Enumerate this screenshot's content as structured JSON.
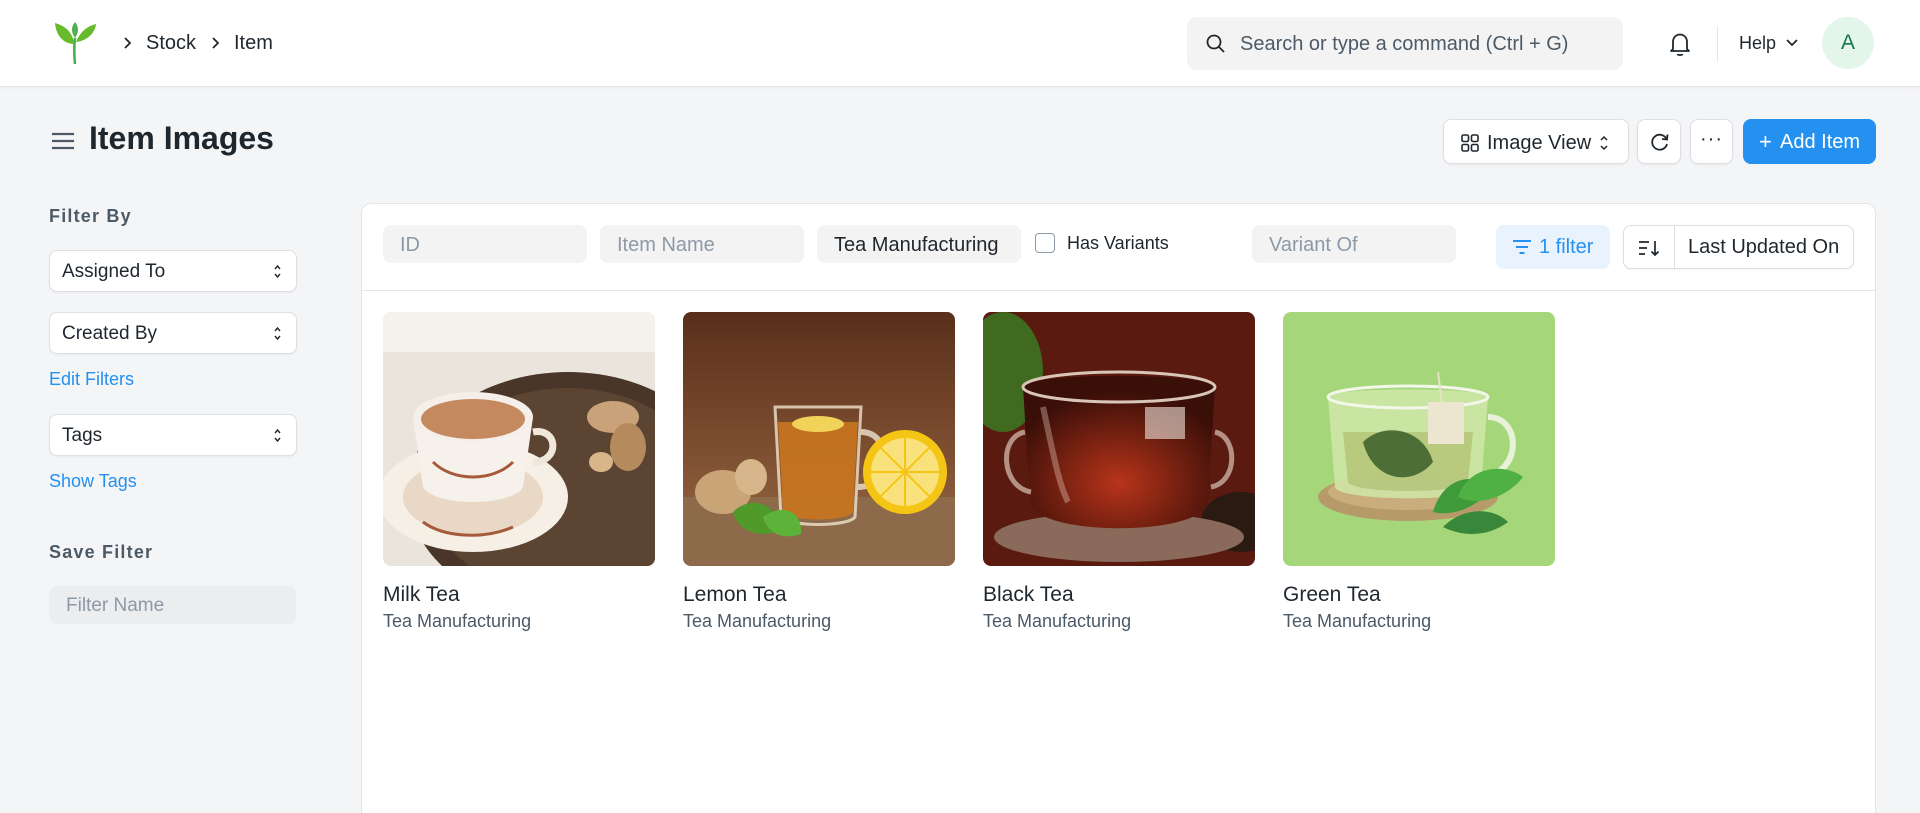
{
  "navbar": {
    "breadcrumbs": [
      "Stock",
      "Item"
    ],
    "search_placeholder": "Search or type a command (Ctrl + G)",
    "help_label": "Help",
    "avatar_initial": "A"
  },
  "page": {
    "title": "Item Images",
    "view_label": "Image View",
    "more_label": "···",
    "add_button_label": "Add Item"
  },
  "sidebar": {
    "filter_by_heading": "Filter By",
    "assigned_to_label": "Assigned To",
    "created_by_label": "Created By",
    "edit_filters_label": "Edit Filters",
    "tags_label": "Tags",
    "show_tags_label": "Show Tags",
    "save_filter_heading": "Save Filter",
    "filter_name_placeholder": "Filter Name"
  },
  "filters": {
    "id_placeholder": "ID",
    "item_name_placeholder": "Item Name",
    "item_group_value": "Tea Manufacturing",
    "has_variants_label": "Has Variants",
    "variant_of_placeholder": "Variant Of",
    "filter_count_label": "1 filter",
    "sort_label": "Last Updated On"
  },
  "items": [
    {
      "name": "Milk Tea",
      "group": "Tea Manufacturing"
    },
    {
      "name": "Lemon Tea",
      "group": "Tea Manufacturing"
    },
    {
      "name": "Black Tea",
      "group": "Tea Manufacturing"
    },
    {
      "name": "Green Tea",
      "group": "Tea Manufacturing"
    }
  ],
  "colors": {
    "accent": "#2490ef",
    "logo_green": "#4caf50",
    "page_background": "#f4f5f6"
  }
}
